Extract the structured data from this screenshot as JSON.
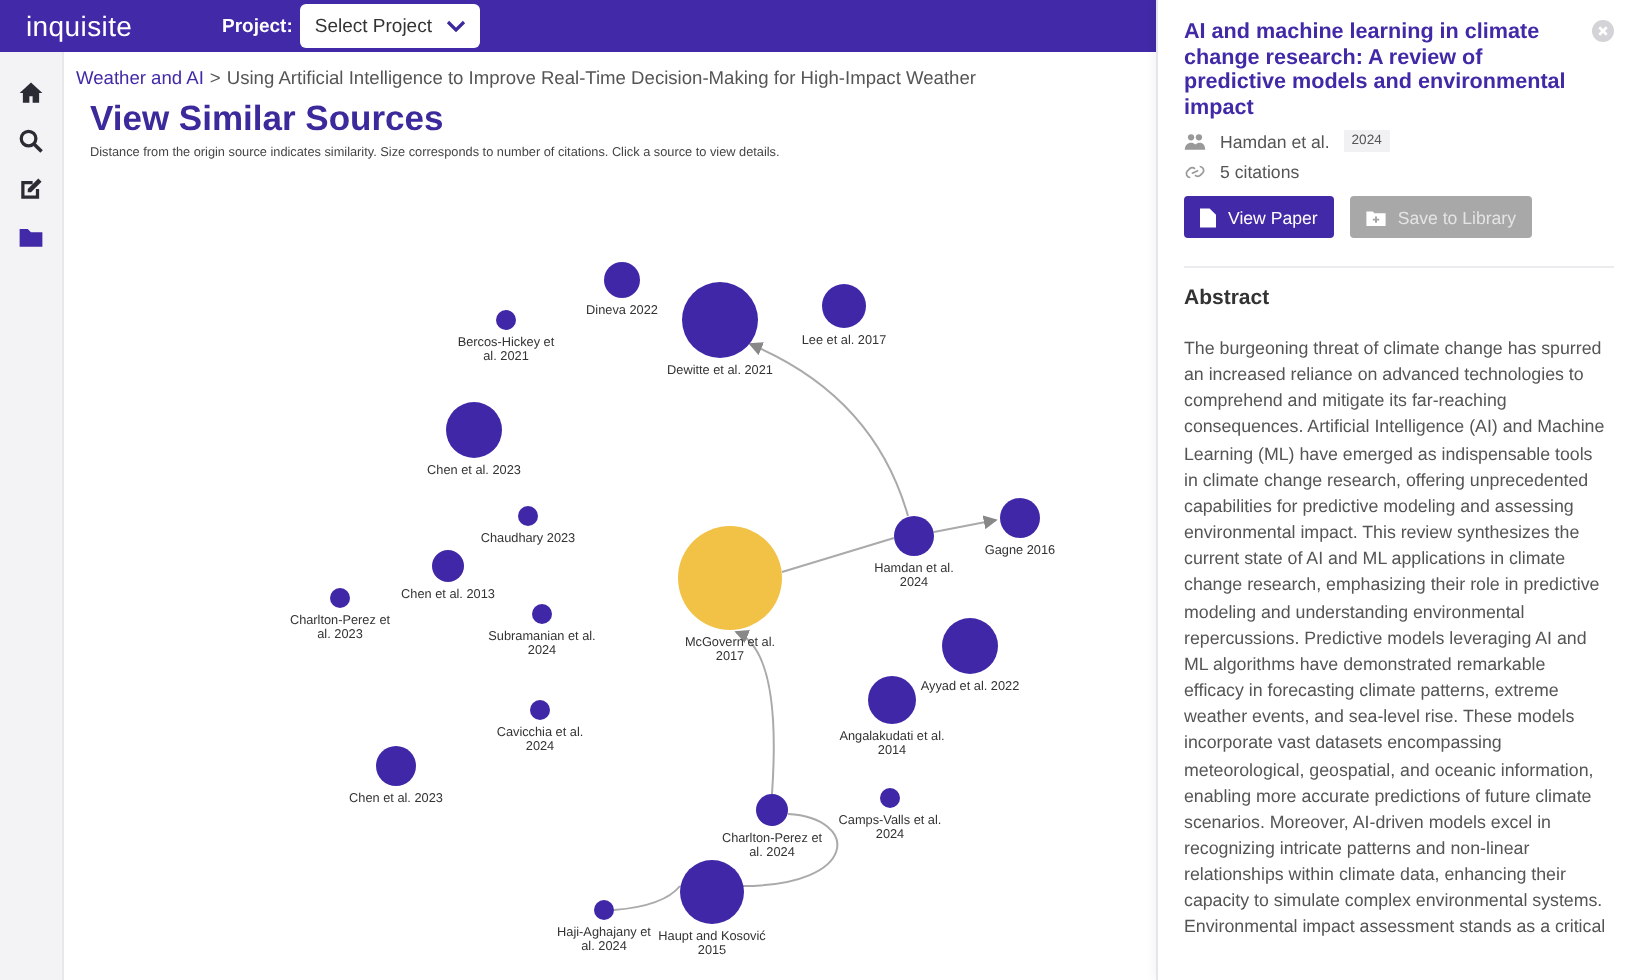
{
  "app": {
    "logo": "inquisite",
    "project_label": "Project:",
    "project_select": "Select Project"
  },
  "sidebar": {
    "items": [
      {
        "selected": false
      },
      {
        "selected": false
      },
      {
        "selected": false
      },
      {
        "selected": true
      }
    ]
  },
  "breadcrumb": {
    "link": "Weather and AI",
    "separator": ">",
    "current": "Using Artificial Intelligence to Improve Real-Time Decision-Making for High-Impact Weather"
  },
  "page": {
    "title": "View Similar Sources",
    "subtitle": "Distance from the origin source indicates similarity. Size corresponds to number of citations. Click a source to view details."
  },
  "graph": {
    "nodes": [
      {
        "label": "Dineva 2022",
        "kind": "source"
      },
      {
        "label": "Bercos-Hickey et al. 2021",
        "kind": "source"
      },
      {
        "label": "Dewitte et al. 2021",
        "kind": "source"
      },
      {
        "label": "Lee et al. 2017",
        "kind": "source"
      },
      {
        "label": "Chen et al. 2023",
        "kind": "source"
      },
      {
        "label": "Chaudhary 2023",
        "kind": "source"
      },
      {
        "label": "Hamdan et al. 2024",
        "kind": "source"
      },
      {
        "label": "Gagne 2016",
        "kind": "source"
      },
      {
        "label": "Charlton-Perez et al. 2023",
        "kind": "source"
      },
      {
        "label": "Chen et al. 2013",
        "kind": "source"
      },
      {
        "label": "Subramanian et al. 2024",
        "kind": "source"
      },
      {
        "label": "McGovern et al. 2017",
        "kind": "origin"
      },
      {
        "label": "Ayyad et al. 2022",
        "kind": "source"
      },
      {
        "label": "Cavicchia et al. 2024",
        "kind": "source"
      },
      {
        "label": "Angalakudati et al. 2014",
        "kind": "source"
      },
      {
        "label": "Chen et al. 2023",
        "kind": "source"
      },
      {
        "label": "Charlton-Perez et al. 2024",
        "kind": "source"
      },
      {
        "label": "Camps-Valls et al. 2024",
        "kind": "source"
      },
      {
        "label": "Haji-Aghajany et al. 2024",
        "kind": "source"
      },
      {
        "label": "Haupt and Kosović 2015",
        "kind": "source"
      }
    ]
  },
  "details": {
    "title": "AI and machine learning in climate change research: A review of predictive models and environmental impact",
    "authors": "Hamdan et al.",
    "year": "2024",
    "citations": "5 citations",
    "buttons": [
      {
        "label": "View Paper",
        "kind": "view",
        "disabled": false
      },
      {
        "label": "Save to Library",
        "kind": "save",
        "disabled": true
      }
    ],
    "abstract_heading": "Abstract",
    "abstract": "The burgeoning threat of climate change has spurred an increased reliance on advanced technologies to comprehend and mitigate its far-reaching consequences. Artificial Intelligence (AI) and Machine Learning (ML) have emerged as indispensable tools in climate change research, offering unprecedented capabilities for predictive modeling and assessing environmental impact. This review synthesizes the current state of AI and ML applications in climate change research, emphasizing their role in predictive modeling and understanding environmental repercussions. Predictive models leveraging AI and ML algorithms have demonstrated remarkable efficacy in forecasting climate patterns, extreme weather events, and sea-level rise. These models incorporate vast datasets encompassing meteorological, geospatial, and oceanic information, enabling more accurate predictions of future climate scenarios. Moreover, AI-driven models excel in recognizing intricate patterns and non-linear relationships within climate data, enhancing their capacity to simulate complex environmental systems. Environmental impact assessment stands as a critical"
  }
}
